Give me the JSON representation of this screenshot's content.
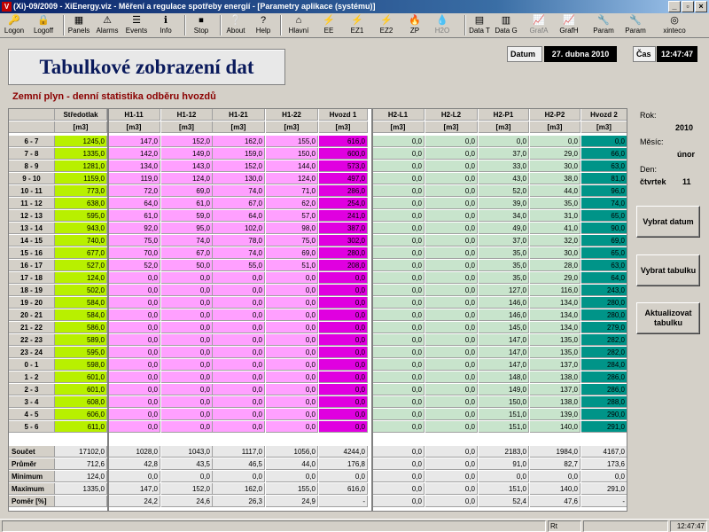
{
  "window": {
    "title": "(Xi)-09/2009 - XiEnergy.viz - Měření a regulace spotřeby energií - [Parametry aplikace (systému)]",
    "app_icon": "V",
    "buttons": [
      "_",
      "▫",
      "×"
    ]
  },
  "toolbar": [
    {
      "label": "Logon",
      "icon": "🔑"
    },
    {
      "label": "Logoff",
      "icon": "🔒"
    },
    {
      "label": "Panels",
      "icon": "▦"
    },
    {
      "label": "Alarms",
      "icon": "⚠"
    },
    {
      "label": "Events",
      "icon": "☰"
    },
    {
      "label": "Info",
      "icon": "ℹ"
    },
    {
      "label": "Stop",
      "icon": "⏹"
    },
    {
      "label": "About",
      "icon": "❔"
    },
    {
      "label": "Help",
      "icon": "?"
    },
    {
      "label": "Hlavní",
      "icon": "⌂"
    },
    {
      "label": "EE",
      "icon": "⚡"
    },
    {
      "label": "EZ1",
      "icon": "⚡"
    },
    {
      "label": "EZ2",
      "icon": "⚡"
    },
    {
      "label": "ZP",
      "icon": "🔥"
    },
    {
      "label": "H2O",
      "icon": "💧",
      "disabled": true
    },
    {
      "label": "Data T",
      "icon": "▤"
    },
    {
      "label": "Data G",
      "icon": "▥"
    },
    {
      "label": "GrafA",
      "icon": "📈",
      "disabled": true
    },
    {
      "label": "GrafH",
      "icon": "📈"
    },
    {
      "label": "Param",
      "icon": "🔧"
    },
    {
      "label": "Param",
      "icon": "🔧"
    },
    {
      "label": "xinteco",
      "icon": "◎"
    }
  ],
  "header": {
    "title": "Tabulkové zobrazení dat",
    "subtitle": "Zemní plyn - denní statistika odběru hvozdů",
    "date_label": "Datum",
    "date_value": "27. dubna 2010",
    "time_label": "Čas",
    "time_value": "12:47:47"
  },
  "colors": {
    "yellow_green": "#b8f000",
    "pink": "#ffa0ff",
    "magenta": "#e000e0",
    "pale_green": "#c8e4cc",
    "teal": "#009488"
  },
  "table": {
    "columns": [
      {
        "name": "Středotlak",
        "unit": "[m3]",
        "color": "yellow_green"
      },
      {
        "name": "H1-11",
        "unit": "[m3]",
        "color": "pink"
      },
      {
        "name": "H1-12",
        "unit": "[m3]",
        "color": "pink"
      },
      {
        "name": "H1-21",
        "unit": "[m3]",
        "color": "pink"
      },
      {
        "name": "H1-22",
        "unit": "[m3]",
        "color": "pink"
      },
      {
        "name": "Hvozd 1",
        "unit": "[m3]",
        "color": "magenta"
      },
      {
        "name": "H2-L1",
        "unit": "[m3]",
        "color": "pale_green"
      },
      {
        "name": "H2-L2",
        "unit": "[m3]",
        "color": "pale_green"
      },
      {
        "name": "H2-P1",
        "unit": "[m3]",
        "color": "pale_green"
      },
      {
        "name": "H2-P2",
        "unit": "[m3]",
        "color": "pale_green"
      },
      {
        "name": "Hvozd 2",
        "unit": "[m3]",
        "color": "teal"
      }
    ],
    "rows": [
      {
        "label": "6 - 7",
        "v": [
          "1245,0",
          "147,0",
          "152,0",
          "162,0",
          "155,0",
          "616,0",
          "0,0",
          "0,0",
          "0,0",
          "0,0",
          "0,0"
        ]
      },
      {
        "label": "7 - 8",
        "v": [
          "1335,0",
          "142,0",
          "149,0",
          "159,0",
          "150,0",
          "600,0",
          "0,0",
          "0,0",
          "37,0",
          "29,0",
          "66,0"
        ]
      },
      {
        "label": "8 - 9",
        "v": [
          "1281,0",
          "134,0",
          "143,0",
          "152,0",
          "144,0",
          "573,0",
          "0,0",
          "0,0",
          "33,0",
          "30,0",
          "63,0"
        ]
      },
      {
        "label": "9 - 10",
        "v": [
          "1159,0",
          "119,0",
          "124,0",
          "130,0",
          "124,0",
          "497,0",
          "0,0",
          "0,0",
          "43,0",
          "38,0",
          "81,0"
        ]
      },
      {
        "label": "10 - 11",
        "v": [
          "773,0",
          "72,0",
          "69,0",
          "74,0",
          "71,0",
          "286,0",
          "0,0",
          "0,0",
          "52,0",
          "44,0",
          "96,0"
        ]
      },
      {
        "label": "11 - 12",
        "v": [
          "638,0",
          "64,0",
          "61,0",
          "67,0",
          "62,0",
          "254,0",
          "0,0",
          "0,0",
          "39,0",
          "35,0",
          "74,0"
        ]
      },
      {
        "label": "12 - 13",
        "v": [
          "595,0",
          "61,0",
          "59,0",
          "64,0",
          "57,0",
          "241,0",
          "0,0",
          "0,0",
          "34,0",
          "31,0",
          "65,0"
        ]
      },
      {
        "label": "13 - 14",
        "v": [
          "943,0",
          "92,0",
          "95,0",
          "102,0",
          "98,0",
          "387,0",
          "0,0",
          "0,0",
          "49,0",
          "41,0",
          "90,0"
        ]
      },
      {
        "label": "14 - 15",
        "v": [
          "740,0",
          "75,0",
          "74,0",
          "78,0",
          "75,0",
          "302,0",
          "0,0",
          "0,0",
          "37,0",
          "32,0",
          "69,0"
        ]
      },
      {
        "label": "15 - 16",
        "v": [
          "677,0",
          "70,0",
          "67,0",
          "74,0",
          "69,0",
          "280,0",
          "0,0",
          "0,0",
          "35,0",
          "30,0",
          "65,0"
        ]
      },
      {
        "label": "16 - 17",
        "v": [
          "527,0",
          "52,0",
          "50,0",
          "55,0",
          "51,0",
          "208,0",
          "0,0",
          "0,0",
          "35,0",
          "28,0",
          "63,0"
        ]
      },
      {
        "label": "17 - 18",
        "v": [
          "124,0",
          "0,0",
          "0,0",
          "0,0",
          "0,0",
          "0,0",
          "0,0",
          "0,0",
          "35,0",
          "29,0",
          "64,0"
        ]
      },
      {
        "label": "18 - 19",
        "v": [
          "502,0",
          "0,0",
          "0,0",
          "0,0",
          "0,0",
          "0,0",
          "0,0",
          "0,0",
          "127,0",
          "116,0",
          "243,0"
        ]
      },
      {
        "label": "19 - 20",
        "v": [
          "584,0",
          "0,0",
          "0,0",
          "0,0",
          "0,0",
          "0,0",
          "0,0",
          "0,0",
          "146,0",
          "134,0",
          "280,0"
        ]
      },
      {
        "label": "20 - 21",
        "v": [
          "584,0",
          "0,0",
          "0,0",
          "0,0",
          "0,0",
          "0,0",
          "0,0",
          "0,0",
          "146,0",
          "134,0",
          "280,0"
        ]
      },
      {
        "label": "21 - 22",
        "v": [
          "586,0",
          "0,0",
          "0,0",
          "0,0",
          "0,0",
          "0,0",
          "0,0",
          "0,0",
          "145,0",
          "134,0",
          "279,0"
        ]
      },
      {
        "label": "22 - 23",
        "v": [
          "589,0",
          "0,0",
          "0,0",
          "0,0",
          "0,0",
          "0,0",
          "0,0",
          "0,0",
          "147,0",
          "135,0",
          "282,0"
        ]
      },
      {
        "label": "23 - 24",
        "v": [
          "595,0",
          "0,0",
          "0,0",
          "0,0",
          "0,0",
          "0,0",
          "0,0",
          "0,0",
          "147,0",
          "135,0",
          "282,0"
        ]
      },
      {
        "label": "0 - 1",
        "v": [
          "598,0",
          "0,0",
          "0,0",
          "0,0",
          "0,0",
          "0,0",
          "0,0",
          "0,0",
          "147,0",
          "137,0",
          "284,0"
        ]
      },
      {
        "label": "1 - 2",
        "v": [
          "601,0",
          "0,0",
          "0,0",
          "0,0",
          "0,0",
          "0,0",
          "0,0",
          "0,0",
          "148,0",
          "138,0",
          "286,0"
        ]
      },
      {
        "label": "2 - 3",
        "v": [
          "601,0",
          "0,0",
          "0,0",
          "0,0",
          "0,0",
          "0,0",
          "0,0",
          "0,0",
          "149,0",
          "137,0",
          "286,0"
        ]
      },
      {
        "label": "3 - 4",
        "v": [
          "608,0",
          "0,0",
          "0,0",
          "0,0",
          "0,0",
          "0,0",
          "0,0",
          "0,0",
          "150,0",
          "138,0",
          "288,0"
        ]
      },
      {
        "label": "4 - 5",
        "v": [
          "606,0",
          "0,0",
          "0,0",
          "0,0",
          "0,0",
          "0,0",
          "0,0",
          "0,0",
          "151,0",
          "139,0",
          "290,0"
        ]
      },
      {
        "label": "5 - 6",
        "v": [
          "611,0",
          "0,0",
          "0,0",
          "0,0",
          "0,0",
          "0,0",
          "0,0",
          "0,0",
          "151,0",
          "140,0",
          "291,0"
        ]
      }
    ],
    "stats": [
      {
        "label": "Součet",
        "v": [
          "17102,0",
          "1028,0",
          "1043,0",
          "1117,0",
          "1056,0",
          "4244,0",
          "0,0",
          "0,0",
          "2183,0",
          "1984,0",
          "4167,0"
        ]
      },
      {
        "label": "Průměr",
        "v": [
          "712,6",
          "42,8",
          "43,5",
          "46,5",
          "44,0",
          "176,8",
          "0,0",
          "0,0",
          "91,0",
          "82,7",
          "173,6"
        ]
      },
      {
        "label": "Minimum",
        "v": [
          "124,0",
          "0,0",
          "0,0",
          "0,0",
          "0,0",
          "0,0",
          "0,0",
          "0,0",
          "0,0",
          "0,0",
          "0,0"
        ]
      },
      {
        "label": "Maximum",
        "v": [
          "1335,0",
          "147,0",
          "152,0",
          "162,0",
          "155,0",
          "616,0",
          "0,0",
          "0,0",
          "151,0",
          "140,0",
          "291,0"
        ]
      },
      {
        "label": "Poměr [%]",
        "v": [
          "",
          "24,2",
          "24,6",
          "26,3",
          "24,9",
          "-",
          "0,0",
          "0,0",
          "52,4",
          "47,6",
          "-"
        ]
      }
    ]
  },
  "side": {
    "rok_label": "Rok:",
    "rok_value": "2010",
    "mesic_label": "Měsíc:",
    "mesic_value": "únor",
    "den_label": "Den:",
    "den_day": "čtvrtek",
    "den_num": "11",
    "btn_date": "Vybrat datum",
    "btn_table": "Vybrat tabulku",
    "btn_refresh": "Aktualizovat tabulku"
  },
  "status": {
    "panel1": "Rt",
    "clock": "12:47:47"
  }
}
